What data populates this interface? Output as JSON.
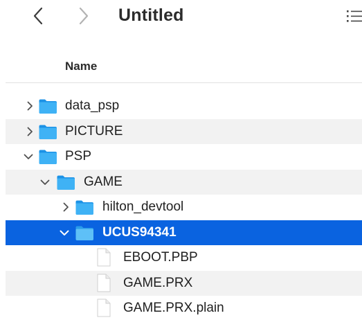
{
  "window": {
    "title": "Untitled"
  },
  "toolbar": {
    "back_icon": "chevron-left-icon",
    "forward_icon": "chevron-right-icon",
    "view_icon": "list-view-icon"
  },
  "columns": {
    "name": "Name"
  },
  "rows": [
    {
      "label": "data_psp",
      "type": "folder",
      "depth": 0,
      "expanded": false,
      "selected": false
    },
    {
      "label": "PICTURE",
      "type": "folder",
      "depth": 0,
      "expanded": false,
      "selected": false
    },
    {
      "label": "PSP",
      "type": "folder",
      "depth": 0,
      "expanded": true,
      "selected": false
    },
    {
      "label": "GAME",
      "type": "folder",
      "depth": 1,
      "expanded": true,
      "selected": false
    },
    {
      "label": "hilton_devtool",
      "type": "folder",
      "depth": 2,
      "expanded": false,
      "selected": false
    },
    {
      "label": "UCUS94341",
      "type": "folder",
      "depth": 2,
      "expanded": true,
      "selected": true
    },
    {
      "label": "EBOOT.PBP",
      "type": "file",
      "depth": 3,
      "selected": false
    },
    {
      "label": "GAME.PRX",
      "type": "file",
      "depth": 3,
      "selected": false
    },
    {
      "label": "GAME.PRX.plain",
      "type": "file",
      "depth": 3,
      "selected": false
    }
  ],
  "colors": {
    "selection": "#0a63e0",
    "folder": "#33a8f2",
    "alt_row": "#f2f2f2"
  }
}
